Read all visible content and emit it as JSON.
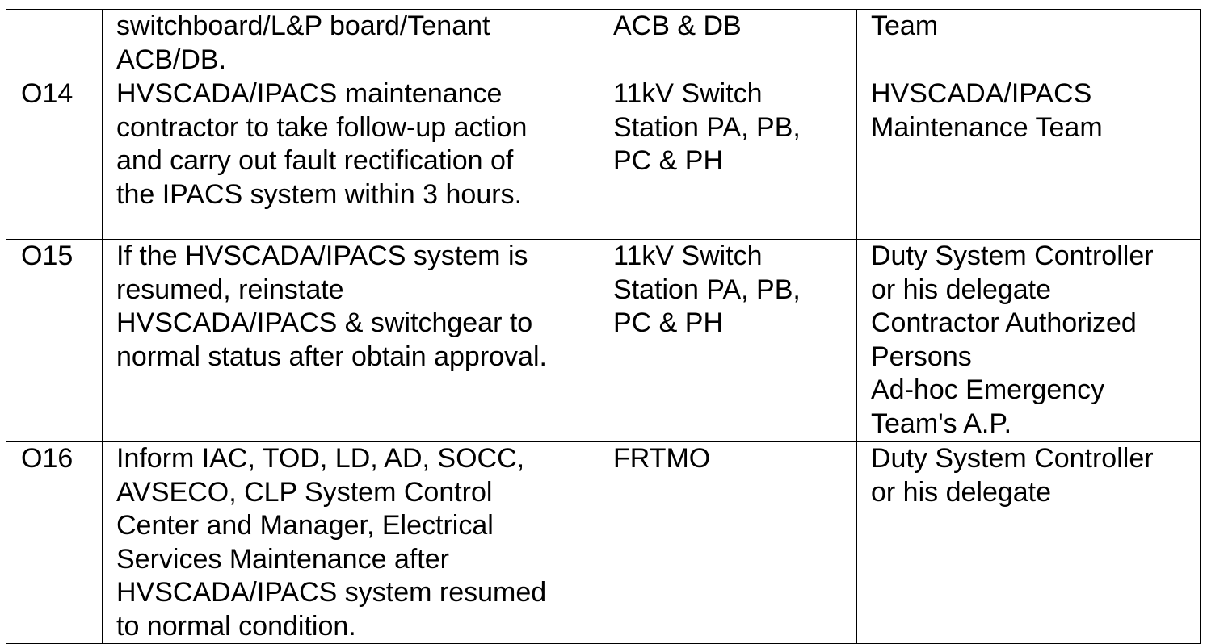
{
  "rows": [
    {
      "id": "",
      "action": [
        "switchboard/L&P board/Tenant",
        "ACB/DB."
      ],
      "location": [
        "ACB & DB"
      ],
      "responsible": [
        "Team"
      ]
    },
    {
      "id": "O14",
      "action": [
        "HVSCADA/IPACS maintenance",
        "contractor to take follow-up action",
        "and carry out fault rectification of",
        "the IPACS system within 3 hours."
      ],
      "location": [
        "11kV Switch",
        "Station PA, PB,",
        "PC & PH"
      ],
      "responsible": [
        "HVSCADA/IPACS",
        "Maintenance Team"
      ]
    },
    {
      "id": "O15",
      "action": [
        "If the HVSCADA/IPACS system is",
        "resumed, reinstate",
        "HVSCADA/IPACS & switchgear to",
        "normal status after obtain approval."
      ],
      "location": [
        "11kV Switch",
        "Station PA, PB,",
        "PC & PH"
      ],
      "responsible": [
        "Duty System Controller",
        "or his delegate",
        "Contractor Authorized",
        "Persons",
        "Ad-hoc Emergency",
        "Team's A.P."
      ]
    },
    {
      "id": "O16",
      "action": [
        "Inform IAC, TOD, LD, AD, SOCC,",
        "AVSECO, CLP System Control",
        "Center and Manager, Electrical",
        "Services Maintenance after",
        "HVSCADA/IPACS system resumed",
        "to normal condition."
      ],
      "location": [
        "FRTMO"
      ],
      "responsible": [
        "Duty System Controller",
        "or his delegate"
      ]
    }
  ]
}
